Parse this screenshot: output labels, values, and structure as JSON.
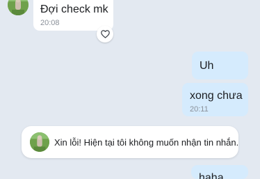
{
  "conversation": {
    "incoming": {
      "text": "Đợi check mk",
      "time": "20:08",
      "avatar_icon": "contact-avatar-photo",
      "reaction_icon": "heart-outline-icon"
    },
    "outgoing": [
      {
        "text": "Uh",
        "time": ""
      },
      {
        "text": "xong chưa",
        "time": "20:11"
      },
      {
        "text": "haha",
        "time": ""
      }
    ],
    "system_notice": {
      "text": "Xin lỗi! Hiện tại tôi không muốn nhận tin nhắn.",
      "avatar_icon": "contact-avatar-photo"
    }
  },
  "colors": {
    "background": "#e3e9f1",
    "outgoing_bubble": "#d5ebfd",
    "incoming_bubble": "#ffffff",
    "time_text": "#8a9099"
  }
}
